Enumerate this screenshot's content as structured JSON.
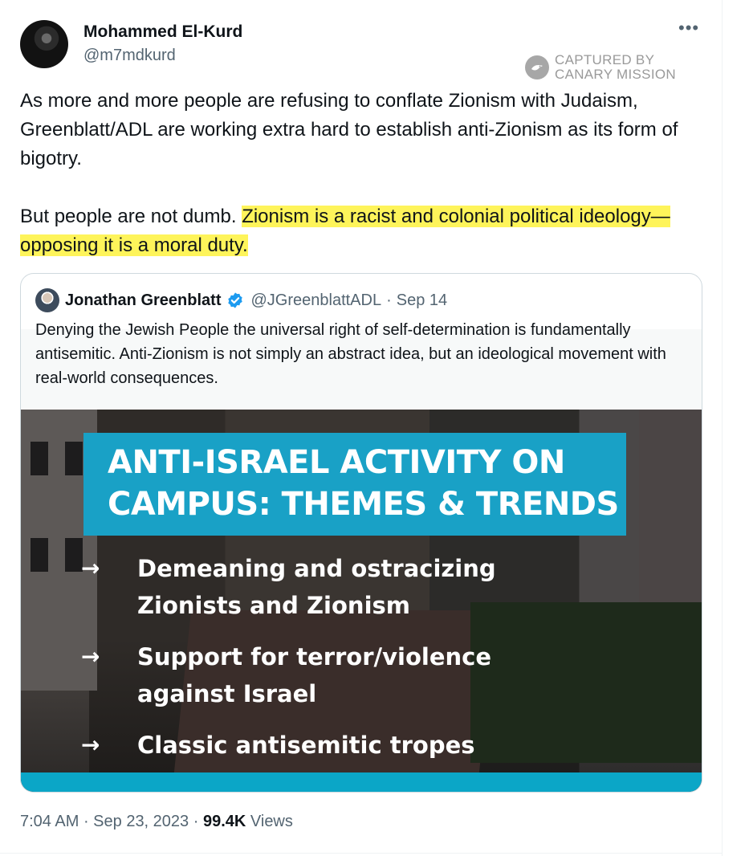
{
  "tweet": {
    "author_name": "Mohammed El-Kurd",
    "author_handle": "@m7mdkurd",
    "more_label": "•••",
    "text_para1": "As more and more people are refusing to conflate Zionism with Judaism, Greenblatt/ADL are working extra hard to establish anti-Zionism as its form of bigotry.",
    "text_para2_plain": "But people are not dumb. ",
    "text_para2_highlight": "Zionism is a racist and colonial political ideology—opposing it is a moral duty.",
    "time": "7:04 AM",
    "date": "Sep 23, 2023",
    "views_count": "99.4K",
    "views_label": "Views"
  },
  "watermark": {
    "line1": "CAPTURED BY",
    "line2": "CANARY MISSION"
  },
  "quoted": {
    "author_name": "Jonathan Greenblatt",
    "author_handle": "@JGreenblattADL",
    "separator": "·",
    "date": "Sep 14",
    "text": "Denying the Jewish People the universal right of self-determination is fundamentally antisemitic. Anti-Zionism is not simply an abstract idea, but an ideological movement with real-world consequences.",
    "media": {
      "banner_line1": "ANTI-ISRAEL ACTIVITY ON",
      "banner_line2": "CAMPUS: THEMES & TRENDS",
      "bullets": [
        {
          "arrow": "→",
          "line1": "Demeaning and ostracizing",
          "line2": "Zionists and Zionism"
        },
        {
          "arrow": "→",
          "line1": "Support for terror/violence",
          "line2": "against Israel"
        },
        {
          "arrow": "→",
          "line1": "Classic antisemitic tropes",
          "line2": ""
        }
      ]
    }
  },
  "colors": {
    "highlight": "#fef45a",
    "verified": "#1d9bf0",
    "banner": "#19a1c6",
    "secondary_text": "#536471"
  },
  "icons": {
    "verified": "verified-badge-icon",
    "watermark": "canary-mission-logo-icon",
    "more": "more-options-icon"
  }
}
